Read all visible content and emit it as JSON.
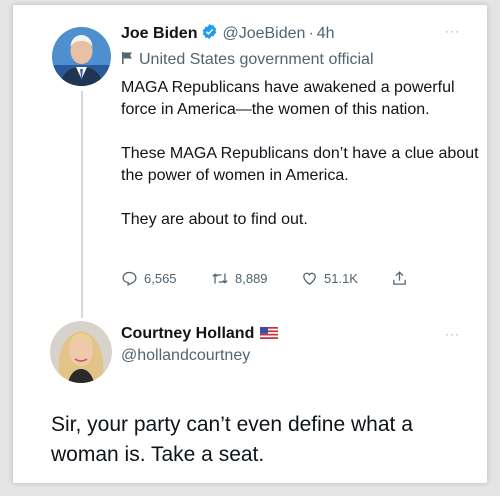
{
  "tweet": {
    "author_name": "Joe Biden",
    "handle": "@JoeBiden",
    "separator": "·",
    "time": "4h",
    "label": "United States government official",
    "paragraphs": [
      "MAGA Republicans have awakened a powerful force in America—the women of this nation.",
      "These MAGA Republicans don’t have a clue about the power of women in America.",
      "They are about to find out."
    ],
    "stats": {
      "replies": "6,565",
      "retweets": "8,889",
      "likes": "51.1K"
    },
    "more": "···"
  },
  "reply": {
    "author_name": "Courtney Holland",
    "handle": "@hollandcourtney",
    "text": "Sir, your party can’t even define what a woman is. Take a seat.",
    "more": "···"
  },
  "colors": {
    "verified_blue": "#1d9bf0",
    "text_primary": "#0f1419",
    "text_secondary": "#536471",
    "thread_line": "#cfd9de"
  },
  "icons": [
    "verified-badge-icon",
    "flag-label-icon",
    "reply-icon",
    "retweet-icon",
    "like-icon",
    "share-icon",
    "us-flag-icon",
    "more-icon"
  ]
}
